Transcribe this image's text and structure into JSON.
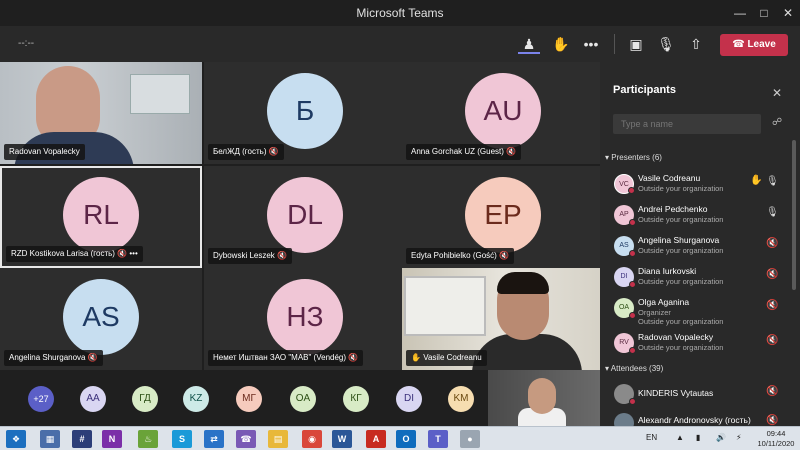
{
  "window": {
    "title": "Microsoft Teams"
  },
  "toolbar": {
    "timer": "--:--",
    "leave_label": "Leave"
  },
  "tiles": [
    {
      "label": "Radovan Vopalecky",
      "initials": "",
      "muted": false
    },
    {
      "label": "БелЖД (гость)",
      "initials": "Б",
      "muted": true
    },
    {
      "label": "Anna Gorchak UZ (Guest)",
      "initials": "AU",
      "muted": true
    },
    {
      "label": "RZD Kostikova Larisa (гость)",
      "initials": "RL",
      "muted": true
    },
    {
      "label": "Dybowski Leszek",
      "initials": "DL",
      "muted": true
    },
    {
      "label": "Edyta Pohibielko (Gość)",
      "initials": "EP",
      "muted": true
    },
    {
      "label": "Angelina Shurganova",
      "initials": "AS",
      "muted": true
    },
    {
      "label": "Немет Иштван ЗАО \"МАВ\" (Vendég)",
      "initials": "НЗ",
      "muted": true
    },
    {
      "label": "Vasile Codreanu",
      "initials": "",
      "muted": false
    }
  ],
  "strip": {
    "more": "+27",
    "chips": [
      "AA",
      "ГД",
      "KZ",
      "МГ",
      "OA",
      "КГ",
      "DI",
      "KM"
    ]
  },
  "panel": {
    "title": "Participants",
    "search_placeholder": "Type a name",
    "presenters_header": "Presenters (6)",
    "attendees_header": "Attendees (39)",
    "presenters": [
      {
        "initials": "VC",
        "name": "Vasile Codreanu",
        "sub": "Outside your organization",
        "sub2": "",
        "hand": true,
        "muted": false
      },
      {
        "initials": "AP",
        "name": "Andrei Pedchenko",
        "sub": "Outside your organization",
        "sub2": "",
        "hand": false,
        "muted": false
      },
      {
        "initials": "AS",
        "name": "Angelina Shurganova",
        "sub": "Outside your organization",
        "sub2": "",
        "hand": false,
        "muted": true
      },
      {
        "initials": "DI",
        "name": "Diana Iurkovski",
        "sub": "Outside your organization",
        "sub2": "",
        "hand": false,
        "muted": true
      },
      {
        "initials": "OA",
        "name": "Olga Aganina",
        "sub": "Organizer",
        "sub2": "Outside your organization",
        "hand": false,
        "muted": true
      },
      {
        "initials": "RV",
        "name": "Radovan Vopalecky",
        "sub": "Outside your organization",
        "sub2": "",
        "hand": false,
        "muted": true
      }
    ],
    "attendees": [
      {
        "initials": "",
        "name": "KINDERIS Vytautas",
        "sub": "",
        "muted": true
      },
      {
        "initials": "",
        "name": "Alexandr Andronovsky (гость)",
        "sub": "",
        "muted": true
      }
    ]
  },
  "taskbar": {
    "language": "EN",
    "time": "09:44",
    "date": "10/11/2020"
  },
  "colors": {
    "avatar_bg": "#f0c6d6",
    "avatar_fg": "#5c2547",
    "leave": "#c4314b",
    "accent": "#7b83eb"
  }
}
